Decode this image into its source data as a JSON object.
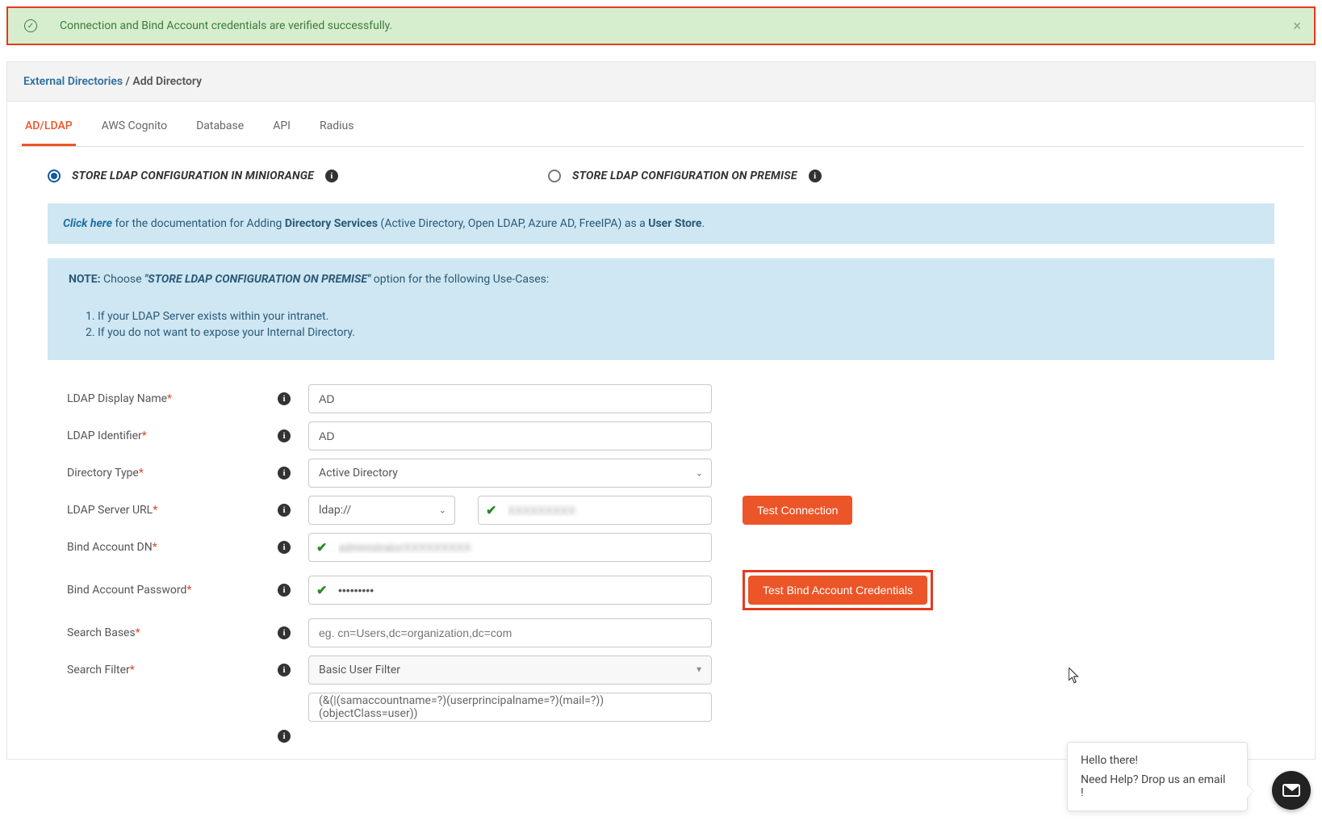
{
  "alert": {
    "text": "Connection and Bind Account credentials are verified successfully."
  },
  "breadcrumb": {
    "parent": "External Directories",
    "sep": " / ",
    "current": "Add Directory"
  },
  "tabs": {
    "ad_ldap": "AD/LDAP",
    "aws": "AWS Cognito",
    "db": "Database",
    "api": "API",
    "radius": "Radius"
  },
  "radios": {
    "miniorange": "STORE LDAP CONFIGURATION IN MINIORANGE",
    "onprem": "STORE LDAP CONFIGURATION ON PREMISE"
  },
  "docbox": {
    "link": "Click here",
    "t1": " for the documentation for Adding ",
    "b1": "Directory Services",
    "t2": " (Active Directory, Open LDAP, Azure AD, FreeIPA) as a ",
    "b2": "User Store",
    "dot": "."
  },
  "note": {
    "label": "NOTE:",
    "lead": "  Choose ",
    "quote": "\"STORE LDAP CONFIGURATION ON PREMISE\"",
    "tail": " option for the following Use-Cases:",
    "li1": "If your LDAP Server exists within your intranet.",
    "li2": "If you do not want to expose your Internal Directory."
  },
  "labels": {
    "display": "LDAP Display Name",
    "identifier": "LDAP Identifier",
    "dirtype": "Directory Type",
    "url": "LDAP Server URL",
    "binddn": "Bind Account DN",
    "bindpw": "Bind Account Password",
    "bases": "Search Bases",
    "filter": "Search Filter"
  },
  "values": {
    "display": "AD",
    "identifier": "AD",
    "dirtype": "Active Directory",
    "scheme": "ldap://",
    "server": "XXXXXXXXX",
    "binddn": "administratorXXXXXXXXX",
    "bindpw": "•••••••••",
    "bases_ph": "eg. cn=Users,dc=organization,dc=com",
    "filter_sel": "Basic User Filter",
    "filter_val": "(&(|(samaccountname=?)(userprincipalname=?)(mail=?))(objectClass=user))"
  },
  "buttons": {
    "test_conn": "Test Connection",
    "test_bind": "Test Bind Account Credentials"
  },
  "chat": {
    "hello": "Hello there!",
    "help": "Need Help? Drop us an email !"
  }
}
